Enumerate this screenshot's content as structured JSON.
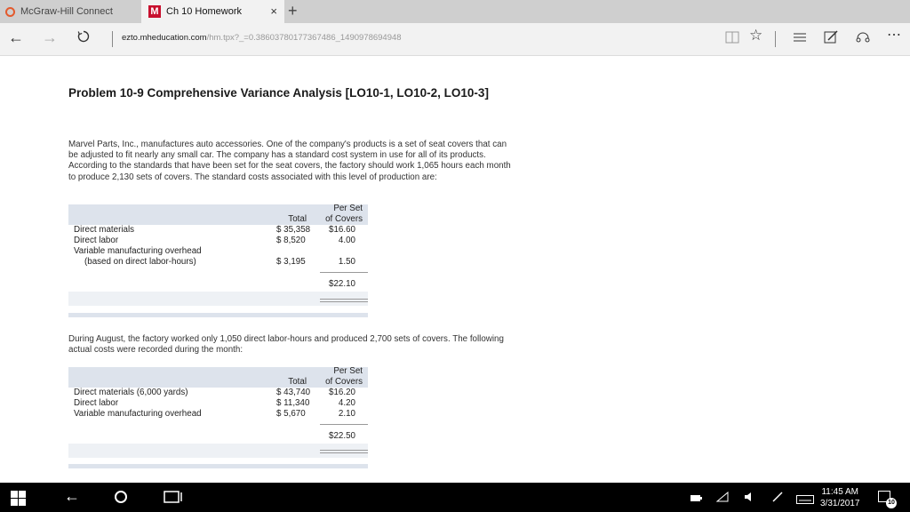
{
  "browser": {
    "tabs": [
      {
        "label": "McGraw-Hill Connect"
      },
      {
        "label": "Ch 10 Homework",
        "icon_letter": "M",
        "close_glyph": "×"
      }
    ],
    "url_host": "ezto.mheducation.com",
    "url_rest": "/hm.tpx?_=0.38603780177367486_1490978694948"
  },
  "problem": {
    "title": "Problem 10-9 Comprehensive Variance Analysis [LO10-1, LO10-2, LO10-3]",
    "intro": "Marvel Parts, Inc., manufactures auto accessories. One of the company's products is a set of seat covers that can be adjusted to fit nearly any small car. The company has a standard cost system in use for all of its products. According to the standards that have been set for the seat covers, the factory should work 1,065 hours each month to produce 2,130 sets of covers. The standard costs associated with this level of production are:",
    "mid": "During August, the factory worked only 1,050 direct labor-hours and produced 2,700 sets of covers. The following actual costs were recorded during the month:"
  },
  "standard_table": {
    "col_total": "Total",
    "col_per_1": "Per Set",
    "col_per_2": "of Covers",
    "rows": [
      {
        "label": "Direct materials",
        "total": "$ 35,358",
        "per": "$16.60"
      },
      {
        "label": "Direct labor",
        "total": "$  8,520",
        "per": "4.00"
      },
      {
        "label": "Variable manufacturing overhead",
        "total": "",
        "per": ""
      },
      {
        "label": "(based on direct labor-hours)",
        "total": "$  3,195",
        "per": "1.50"
      }
    ],
    "sum": "$22.10"
  },
  "actual_table": {
    "col_total": "Total",
    "col_per_1": "Per Set",
    "col_per_2": "of Covers",
    "rows": [
      {
        "label": "Direct materials (6,000 yards)",
        "total": "$ 43,740",
        "per": "$16.20"
      },
      {
        "label": "Direct labor",
        "total": "$ 11,340",
        "per": "4.20"
      },
      {
        "label": "Variable manufacturing overhead",
        "total": "$  5,670",
        "per": "2.10"
      }
    ],
    "sum": "$22.50"
  },
  "taskbar": {
    "time": "11:45 AM",
    "date": "3/31/2017",
    "notifications": "10"
  }
}
